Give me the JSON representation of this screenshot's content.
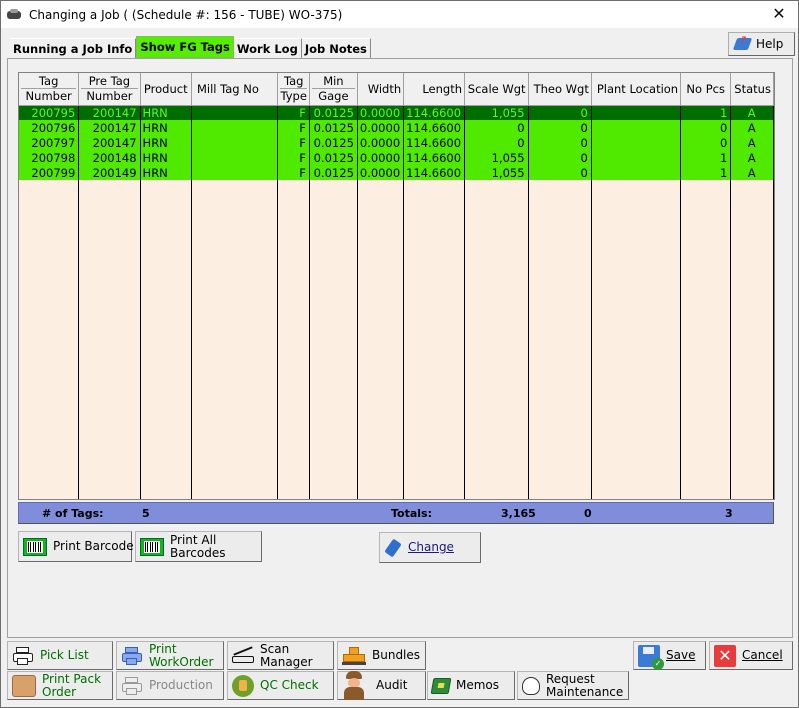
{
  "window": {
    "title": "Changing a Job  (  (Schedule #: 156 - TUBE) WO-375)",
    "close_glyph": "✕"
  },
  "tabs": [
    {
      "label": "Running a Job Info",
      "active": false
    },
    {
      "label": "Show FG Tags",
      "active": true
    },
    {
      "label": "Work Log",
      "active": false
    },
    {
      "label": "Job Notes",
      "active": false
    }
  ],
  "help_button": {
    "label": "Help",
    "icon": "help-book-icon"
  },
  "grid": {
    "columns": [
      {
        "line1": "Tag",
        "line2": "Number"
      },
      {
        "line1": "Pre Tag",
        "line2": "Number"
      },
      {
        "line1": "Product",
        "line2": ""
      },
      {
        "line1": "Mill Tag No",
        "line2": ""
      },
      {
        "line1": "Tag",
        "line2": "Type"
      },
      {
        "line1": "Min",
        "line2": "Gage"
      },
      {
        "line1": "Width",
        "line2": ""
      },
      {
        "line1": "Length",
        "line2": ""
      },
      {
        "line1": "Scale Wgt",
        "line2": ""
      },
      {
        "line1": "Theo Wgt",
        "line2": ""
      },
      {
        "line1": "Plant Location",
        "line2": ""
      },
      {
        "line1": "No Pcs",
        "line2": ""
      },
      {
        "line1": "Status",
        "line2": ""
      }
    ],
    "rows": [
      {
        "selected": true,
        "cells": [
          "200795",
          "200147",
          "HRN",
          "",
          "F",
          "0.0125",
          "0.0000",
          "114.6600",
          "1,055",
          "0",
          "",
          "1",
          "A"
        ]
      },
      {
        "selected": false,
        "cells": [
          "200796",
          "200147",
          "HRN",
          "",
          "F",
          "0.0125",
          "0.0000",
          "114.6600",
          "0",
          "0",
          "",
          "0",
          "A"
        ]
      },
      {
        "selected": false,
        "cells": [
          "200797",
          "200147",
          "HRN",
          "",
          "F",
          "0.0125",
          "0.0000",
          "114.6600",
          "0",
          "0",
          "",
          "0",
          "A"
        ]
      },
      {
        "selected": false,
        "cells": [
          "200798",
          "200148",
          "HRN",
          "",
          "F",
          "0.0125",
          "0.0000",
          "114.6600",
          "1,055",
          "0",
          "",
          "1",
          "A"
        ]
      },
      {
        "selected": false,
        "cells": [
          "200799",
          "200149",
          "HRN",
          "",
          "F",
          "0.0125",
          "0.0000",
          "114.6600",
          "1,055",
          "0",
          "",
          "1",
          "A"
        ]
      }
    ]
  },
  "totals": {
    "tags_label": "# of Tags:",
    "tags_value": "5",
    "totals_label": "Totals:",
    "scale_wgt": "3,165",
    "theo_wgt": "0",
    "no_pcs": "3"
  },
  "actions": {
    "print_barcode": "Print Barcode",
    "print_all_barcodes": "Print All Barcodes",
    "change": "Change"
  },
  "bottom_buttons": {
    "pick_list": "Pick List",
    "print_workorder": "Print WorkOrder",
    "scan_manager": "Scan Manager",
    "bundles": "Bundles",
    "print_pack_order": "Print Pack Order",
    "production": "Production",
    "qc_check": "QC Check",
    "audit": "Audit",
    "memos": "Memos",
    "request_maintenance": "Request Maintenance",
    "save": "Save",
    "cancel": "Cancel"
  },
  "colors": {
    "active_tab": "#55ee00",
    "row_bg": "#4fea00",
    "selected_row_bg": "#006d00",
    "grid_empty_bg": "#fdeee2",
    "totals_bar": "#7f8ddb"
  }
}
